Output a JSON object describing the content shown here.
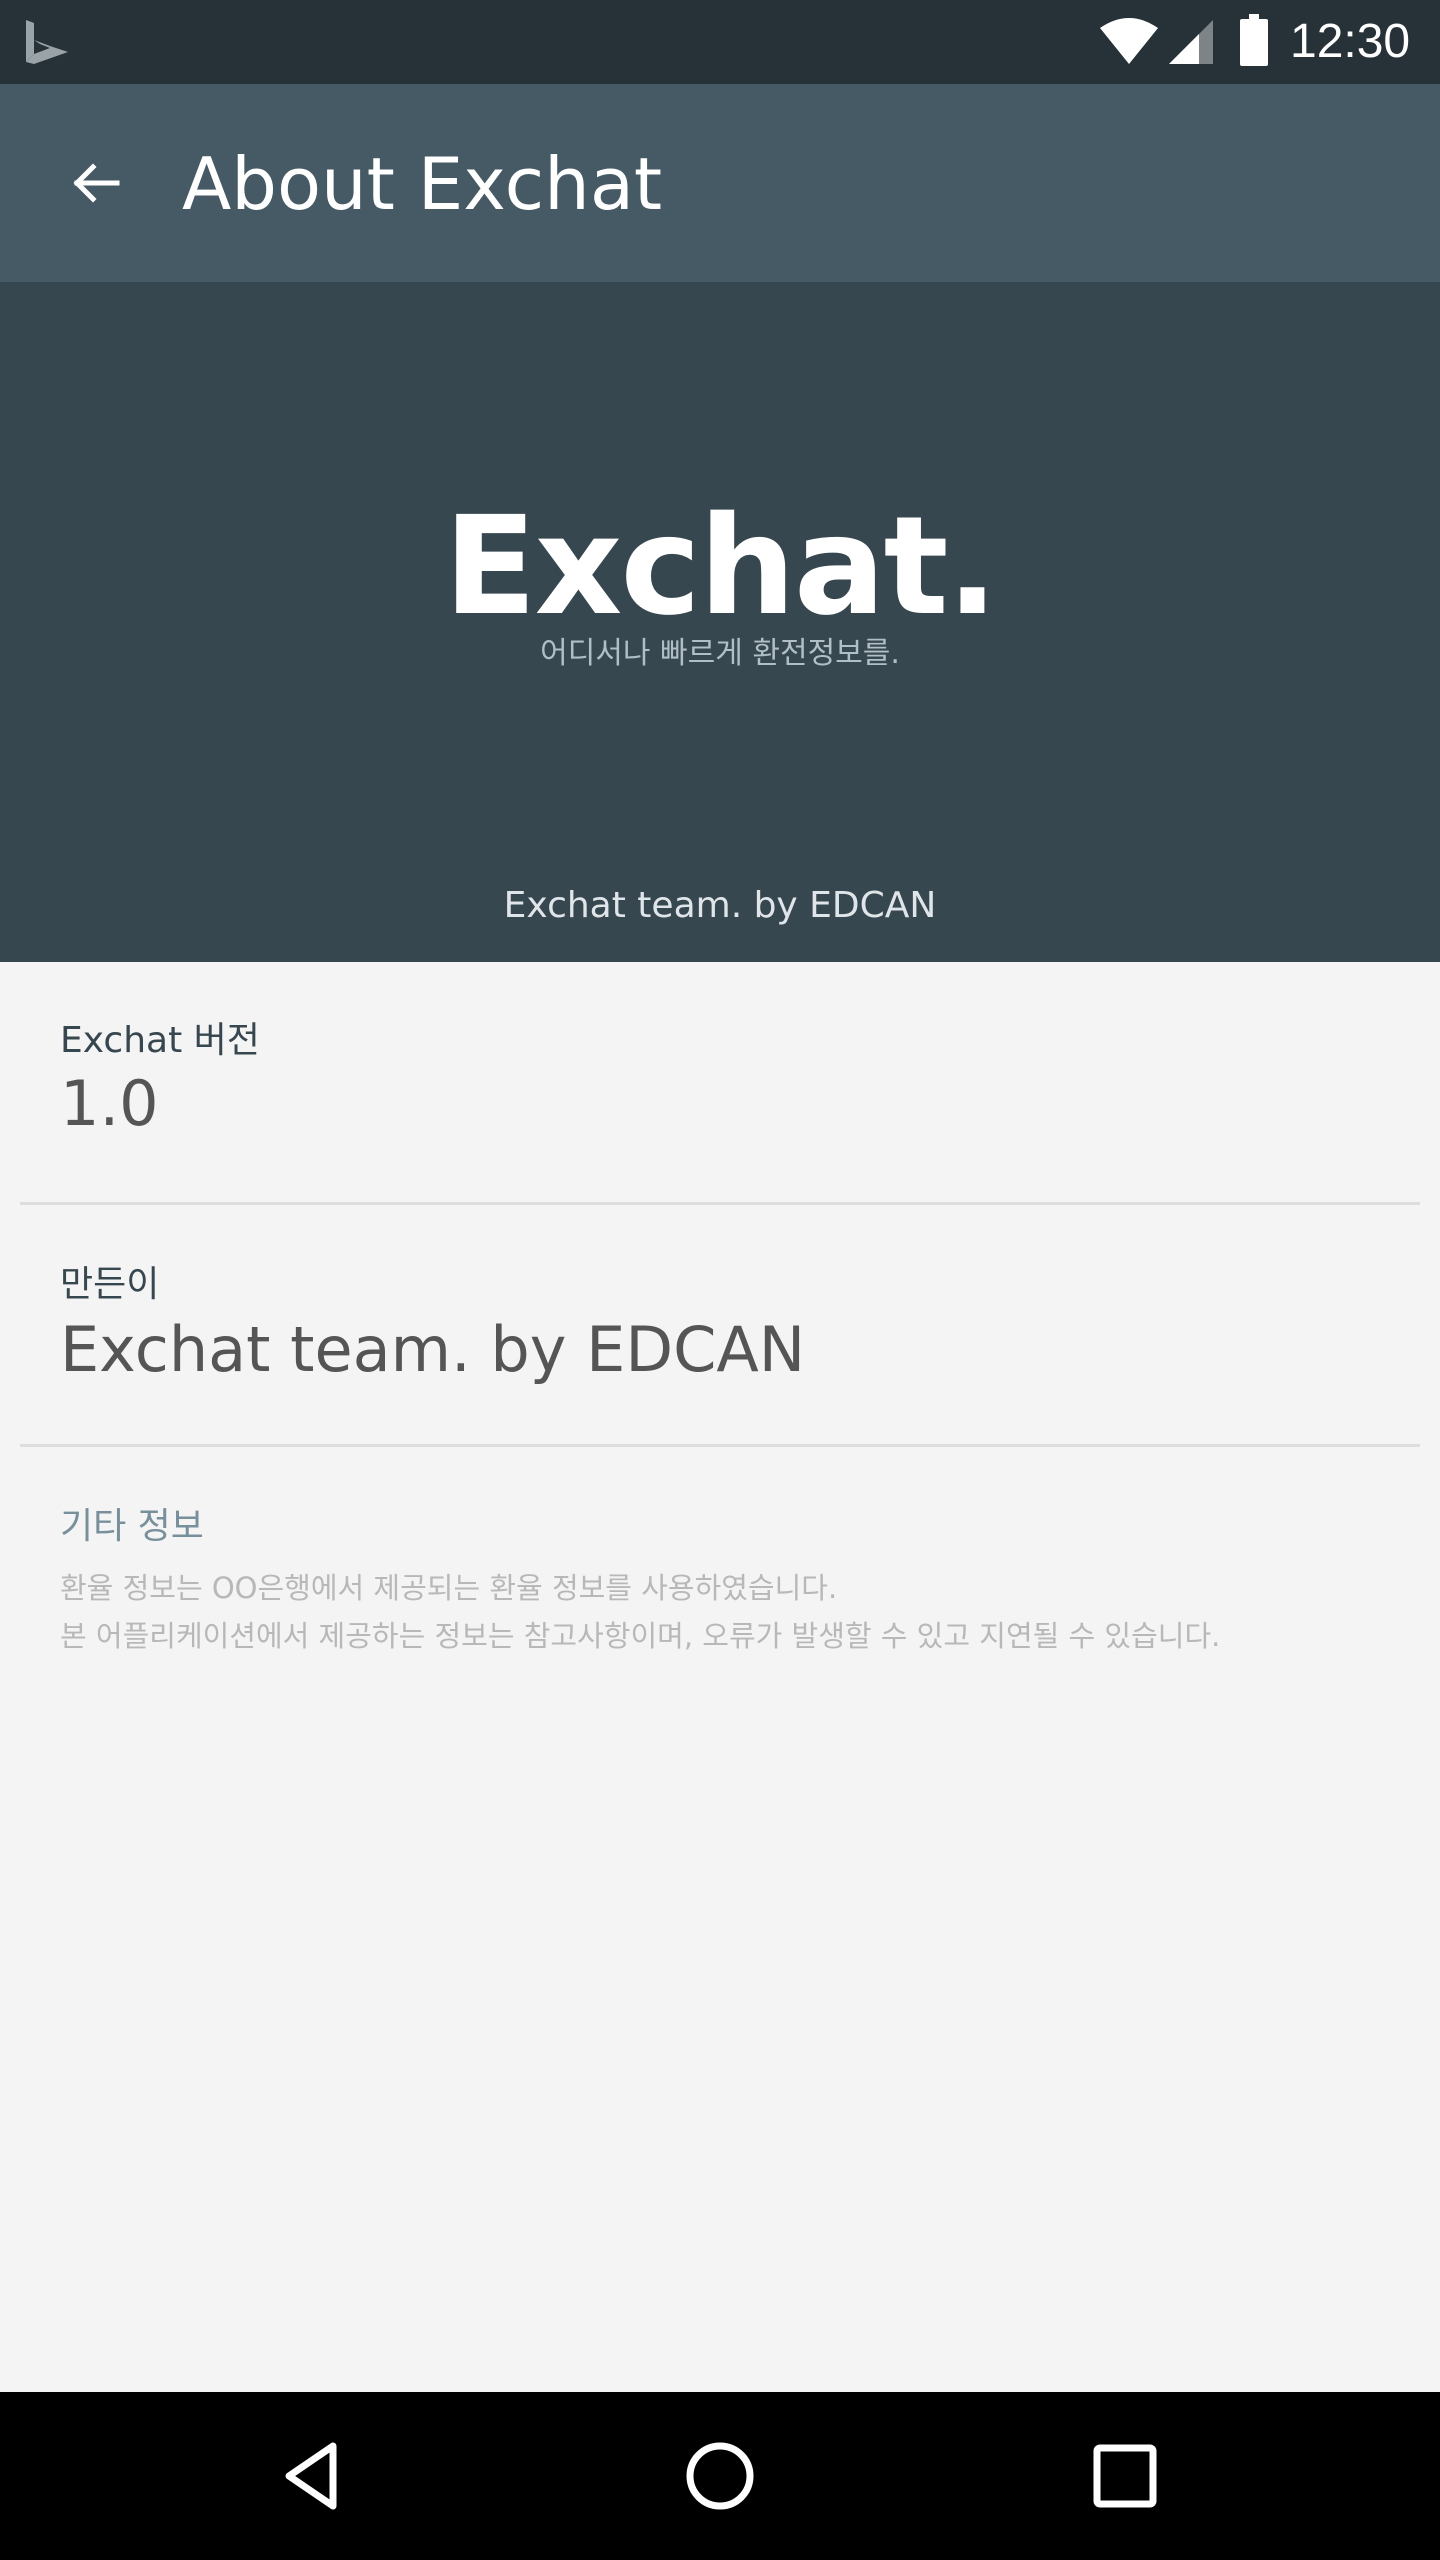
{
  "status_bar": {
    "time": "12:30",
    "icons": [
      "bing-logo-icon",
      "wifi-icon",
      "cellular-signal-icon",
      "battery-icon"
    ]
  },
  "app_bar": {
    "title": "About Exchat",
    "back_icon": "arrow-back-icon"
  },
  "hero": {
    "brand": "Exchat.",
    "tagline": "어디서나 빠르게 환전정보를.",
    "credit": "Exchat team. by EDCAN"
  },
  "version": {
    "label": "Exchat 버전",
    "value": "1.0"
  },
  "maker": {
    "label": "만든이",
    "value": "Exchat team. by EDCAN"
  },
  "other": {
    "title": "기타 정보",
    "note_1": "환율 정보는 OO은행에서 제공되는 환율 정보를 사용하였습니다.",
    "note_2": "본 어플리케이션에서 제공하는 정보는 참고사항이며, 오류가 발생할 수 있고 지연될 수 있습니다."
  },
  "nav_bar": {
    "icons": [
      "nav-back-icon",
      "nav-home-icon",
      "nav-recents-icon"
    ]
  },
  "colors": {
    "status_bar": "#263238",
    "app_bar": "#455a64",
    "hero": "#37474f",
    "background": "#f4f4f4",
    "other_title": "#78909c"
  }
}
